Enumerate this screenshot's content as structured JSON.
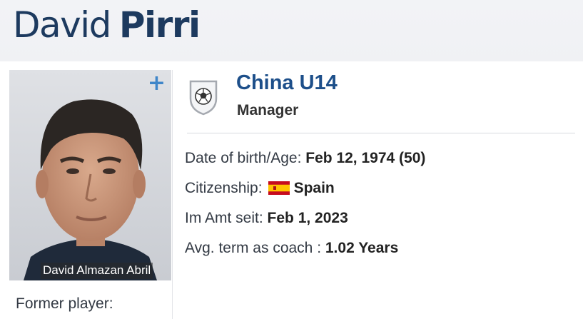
{
  "profile": {
    "first_name": "David",
    "last_name": "Pirri",
    "photo_caption": "David Almazan Abril",
    "former_player_label": "Former player:"
  },
  "club": {
    "name": "China U14",
    "role": "Manager",
    "icon": "football-crest-icon"
  },
  "details": {
    "dob_label": "Date of birth/Age:",
    "dob_value": "Feb 12, 1974 (50)",
    "citizenship_label": "Citizenship:",
    "citizenship_value": "Spain",
    "citizenship_flag": "spain-flag-icon",
    "in_office_label": "Im Amt seit:",
    "in_office_value": "Feb 1, 2023",
    "avg_term_label": "Avg. term as coach :",
    "avg_term_value": "1.02 Years"
  },
  "actions": {
    "plus_symbol": "+"
  },
  "colors": {
    "name": "#1d3a5f",
    "club_name": "#1d4f8a",
    "plus": "#3f86c9"
  }
}
